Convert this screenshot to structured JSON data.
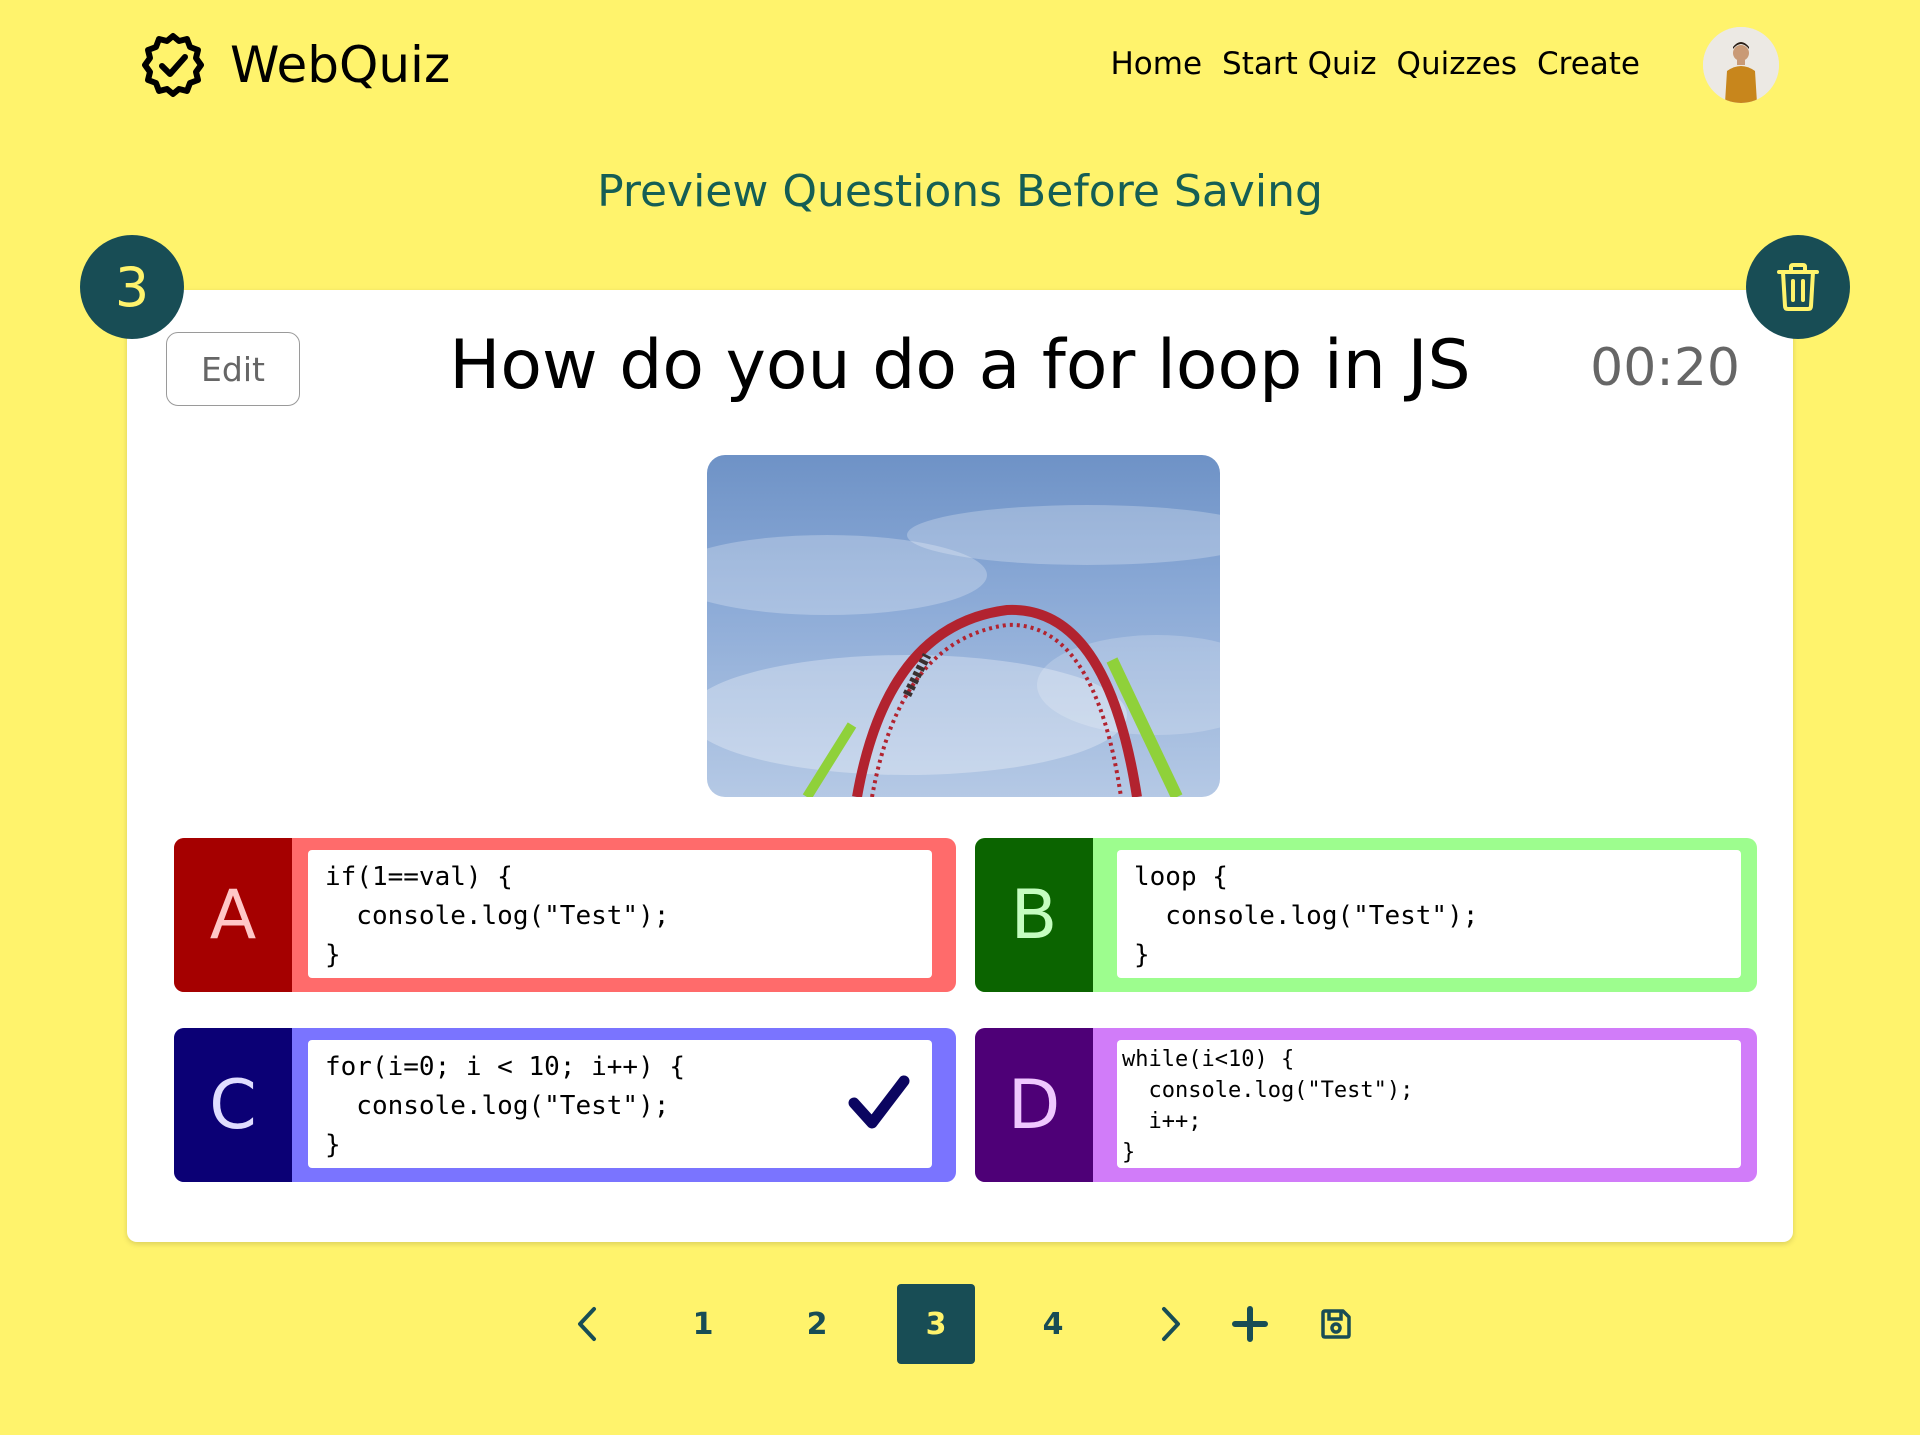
{
  "header": {
    "brand": "WebQuiz",
    "nav": [
      "Home",
      "Start Quiz",
      "Quizzes",
      "Create"
    ]
  },
  "page_title": "Preview Questions Before Saving",
  "question": {
    "number": "3",
    "text": "How do you do a for loop in JS",
    "timer": "00:20",
    "edit_label": "Edit",
    "answers": [
      {
        "letter": "A",
        "code": "if(1==val) {\n  console.log(\"Test\");\n}",
        "correct": false
      },
      {
        "letter": "B",
        "code": "loop {\n  console.log(\"Test\");\n}",
        "correct": false
      },
      {
        "letter": "C",
        "code": "for(i=0; i < 10; i++) {\n  console.log(\"Test\");\n}",
        "correct": true
      },
      {
        "letter": "D",
        "code": "while(i<10) {\n  console.log(\"Test\");\n  i++;\n}",
        "correct": false
      }
    ]
  },
  "pagination": {
    "pages": [
      "1",
      "2",
      "3",
      "4"
    ],
    "current": "3"
  },
  "colors": {
    "background": "#fff36c",
    "accent": "#184d55",
    "title": "#155e55",
    "answer_a": "#ff6b6b",
    "answer_b": "#9dfd8e",
    "answer_c": "#7a74ff",
    "answer_d": "#d17cf9"
  },
  "icons": {
    "logo": "gear-check-icon",
    "delete": "trash-icon",
    "correct": "checkmark-icon",
    "prev": "chevron-left-icon",
    "next": "chevron-right-icon",
    "add": "plus-icon",
    "save": "save-icon"
  }
}
